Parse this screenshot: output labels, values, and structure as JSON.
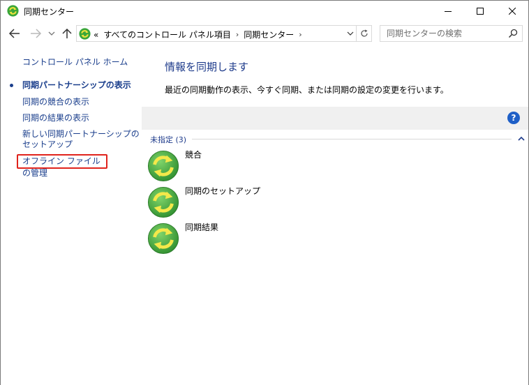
{
  "window": {
    "title": "同期センター"
  },
  "address": {
    "overflow": "«",
    "crumbs": [
      "すべてのコントロール パネル項目",
      "同期センター"
    ],
    "separator": "›"
  },
  "search": {
    "placeholder": "同期センターの検索"
  },
  "sidebar": {
    "home": "コントロール パネル ホーム",
    "items": [
      "同期パートナーシップの表示",
      "同期の競合の表示",
      "同期の結果の表示",
      "新しい同期パートナーシップのセットアップ",
      "オフライン ファイルの管理"
    ]
  },
  "main": {
    "title": "情報を同期します",
    "description": "最近の同期動作の表示、今すぐ同期、または同期の設定の変更を行います。",
    "help": "?",
    "group": {
      "label": "未指定 (3)",
      "items": [
        "競合",
        "同期のセットアップ",
        "同期結果"
      ]
    }
  },
  "colors": {
    "link": "#1a3e8c",
    "highlight_border": "#e0231c",
    "sync_green": "#3aa63a",
    "sync_arrows": "#f0e23c"
  }
}
